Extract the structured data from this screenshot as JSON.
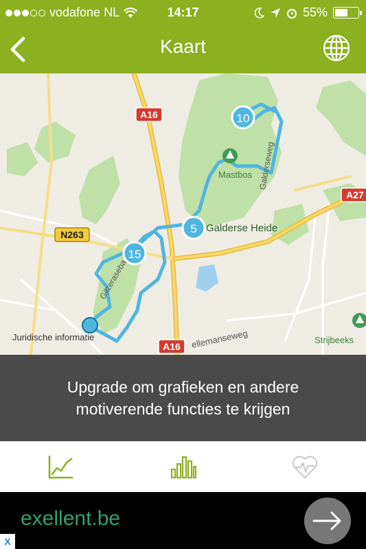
{
  "status_bar": {
    "carrier": "vodafone NL",
    "time": "14:17",
    "battery": "55%",
    "battery_level": 0.55,
    "signal_bars": 3
  },
  "nav": {
    "title": "Kaart",
    "back_icon": "chevron-left-icon",
    "globe_icon": "globe-icon"
  },
  "map": {
    "legal_link": "Juridische informatie",
    "road_labels": [
      "A16",
      "A16",
      "A27",
      "N263"
    ],
    "place_labels": [
      "Mastbos",
      "Galderse Heide",
      "Strijbeeks",
      "Galderseweg",
      "Gilzeraseba",
      "ellemanseweg"
    ],
    "markers": [
      "10",
      "5",
      "15"
    ],
    "route_color": "#4fb6df"
  },
  "upgrade_banner": {
    "text": "Upgrade om grafieken en andere motiverende functies te krijgen"
  },
  "tabs": [
    {
      "icon": "line-chart-icon",
      "active": true
    },
    {
      "icon": "bar-chart-icon",
      "active": true
    },
    {
      "icon": "heart-rate-icon",
      "active": false
    }
  ],
  "ad": {
    "text": "exellent.be",
    "arrow_icon": "arrow-right-icon",
    "badge": "X"
  }
}
